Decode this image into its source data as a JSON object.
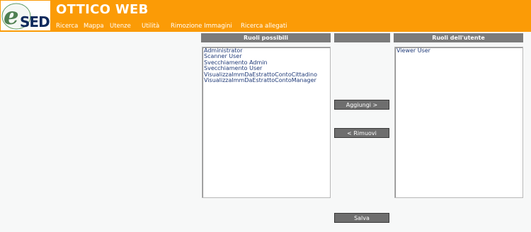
{
  "header": {
    "logo_text": "eSED",
    "title": "OTTICO WEB",
    "nav": [
      "Ricerca",
      "Mappa",
      "Utenze",
      "Utilità",
      "Rimozione Immagini",
      "Ricerca allegati"
    ]
  },
  "available_roles": {
    "title": "Ruoli possibili",
    "items": [
      "Administrator",
      "Scanner User",
      "Svecchiamento Admin",
      "Svecchiamento User",
      "VisualizzaImmDaEstrattoContoCittadino",
      "VisualizzaImmDaEstrattoContoManager"
    ]
  },
  "user_roles": {
    "title": "Ruoli dell'utente",
    "items": [
      "Viewer User"
    ]
  },
  "actions": {
    "add_label": "Aggiungi >",
    "remove_label": "< Rimuovi",
    "save_label": "Salva"
  },
  "colors": {
    "header_bg": "#fb9b06",
    "panel_header_bg": "#7b7b7b",
    "button_bg": "#6e6e6e",
    "list_text": "#1f3a78"
  }
}
